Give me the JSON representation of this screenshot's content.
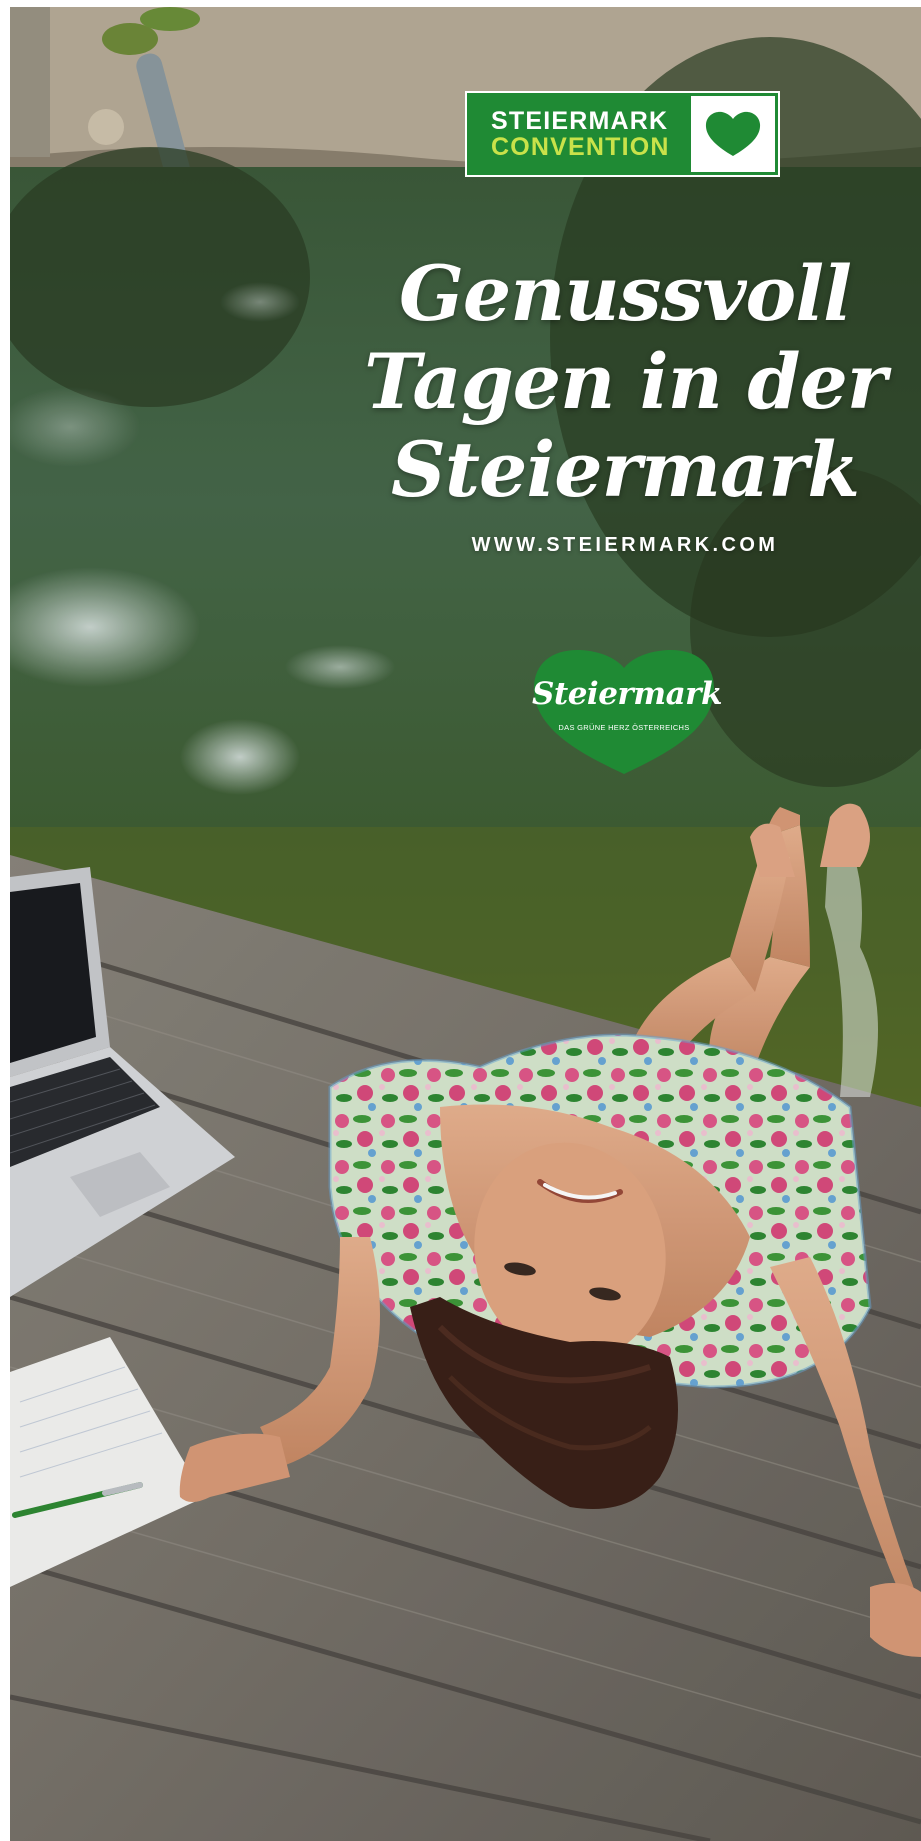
{
  "badge": {
    "line1": "STEIERMARK",
    "line2": "CONVENTION",
    "icon": "heart-icon"
  },
  "headline": {
    "line1": "Genussvoll",
    "line2": "Tagen in der",
    "line3": "Steiermark"
  },
  "website": "WWW.STEIERMARK.COM",
  "logo": {
    "script": "Steiermark",
    "tagline": "DAS GRÜNE HERZ ÖSTERREICHS"
  },
  "colors": {
    "brand_green": "#1f8a34",
    "accent_lime": "#c9e24a",
    "text_white": "#ffffff"
  }
}
